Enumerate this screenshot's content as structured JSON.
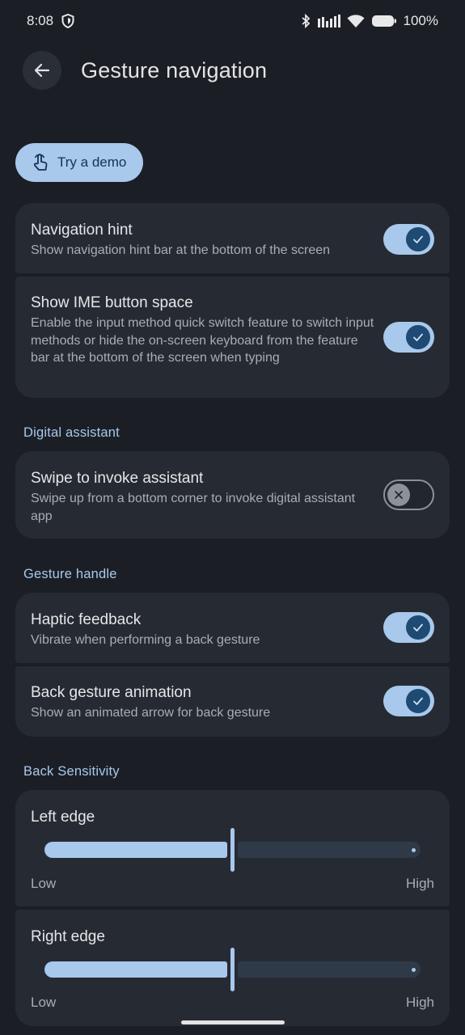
{
  "status_bar": {
    "time": "8:08",
    "battery": "100%"
  },
  "header": {
    "title": "Gesture navigation"
  },
  "demo_button": {
    "label": "Try a demo"
  },
  "navigation_hint": {
    "title": "Navigation hint",
    "subtitle": "Show navigation hint bar at the bottom of the screen",
    "enabled": true
  },
  "ime_space": {
    "title": "Show IME button space",
    "subtitle": "Enable the input method quick switch feature to switch input methods or hide the on-screen keyboard from the feature bar at the bottom of the screen when typing",
    "enabled": true
  },
  "digital_assistant": {
    "header": "Digital assistant",
    "swipe": {
      "title": "Swipe to invoke assistant",
      "subtitle": "Swipe up from a bottom corner to invoke digital assistant app",
      "enabled": false
    }
  },
  "gesture_handle": {
    "header": "Gesture handle",
    "haptic": {
      "title": "Haptic feedback",
      "subtitle": "Vibrate when performing a back gesture",
      "enabled": true
    },
    "animation": {
      "title": "Back gesture animation",
      "subtitle": "Show an animated arrow for back gesture",
      "enabled": true
    }
  },
  "back_sensitivity": {
    "header": "Back Sensitivity",
    "left": {
      "title": "Left edge",
      "low": "Low",
      "high": "High",
      "value": 0.5
    },
    "right": {
      "title": "Right edge",
      "low": "Low",
      "high": "High",
      "value": 0.5
    }
  },
  "colors": {
    "accent": "#a8c8ec",
    "background": "#1b1f25",
    "card": "#262b33"
  }
}
